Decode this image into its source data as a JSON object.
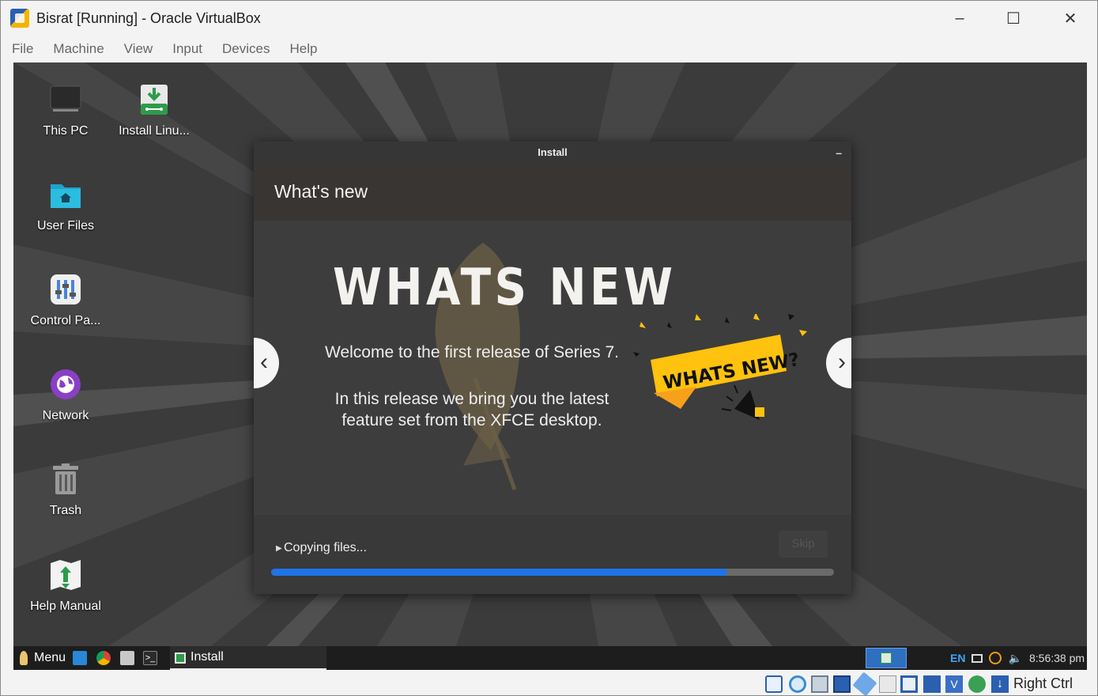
{
  "window": {
    "title": "Bisrat [Running] - Oracle VirtualBox",
    "controls": {
      "minimize": "–",
      "maximize": "☐",
      "close": "✕"
    }
  },
  "menubar": {
    "items": [
      "File",
      "Machine",
      "View",
      "Input",
      "Devices",
      "Help"
    ]
  },
  "desktop": {
    "icons": [
      {
        "label": "This PC",
        "icon": "monitor-icon"
      },
      {
        "label": "Install Linu...",
        "icon": "install-icon"
      },
      {
        "label": "User Files",
        "icon": "home-folder-icon"
      },
      {
        "label": "Control Pa...",
        "icon": "control-panel-icon"
      },
      {
        "label": "Network",
        "icon": "network-globe-icon"
      },
      {
        "label": "Trash",
        "icon": "trash-icon"
      },
      {
        "label": "Help Manual",
        "icon": "help-manual-icon"
      }
    ]
  },
  "installer": {
    "window_title": "Install",
    "minimize": "–",
    "header": "What's new",
    "slide": {
      "title": "WHATS NEW",
      "line1": "Welcome to the first release of Series 7.",
      "line2": "In this release we bring you the latest feature set from the XFCE desktop.",
      "badge_text": "WHATS NEW?",
      "prev": "‹",
      "next": "›"
    },
    "status": "Copying files...",
    "skip_label": "Skip",
    "progress": 0.81,
    "colors": {
      "progress": "#1f74e8",
      "badge": "#ffc20e"
    }
  },
  "taskbar": {
    "menu_label": "Menu",
    "task_label": "Install",
    "language": "EN",
    "clock": "8:56:38 pm"
  },
  "statusbar": {
    "host_key": "Right Ctrl"
  }
}
